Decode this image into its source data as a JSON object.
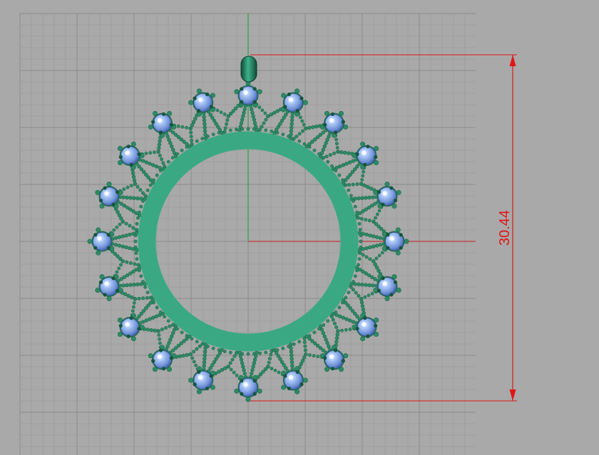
{
  "viewport": {
    "name": "Top",
    "background_color": "#a9a9a9",
    "grid_minor_color": "#9c9c9c",
    "grid_major_color": "#8a8a8a",
    "axis_x_color": "#c0383a",
    "axis_y_color": "#2f9e4a"
  },
  "model": {
    "object": "pendant",
    "ring_color": "#3aa983",
    "metal_color": "#1f6b4f",
    "bead_color": "#2d8a65",
    "gem_color": "#8fb3ee",
    "gem_count": 20
  },
  "dimension": {
    "value": "30.44",
    "color": "#e01515"
  }
}
